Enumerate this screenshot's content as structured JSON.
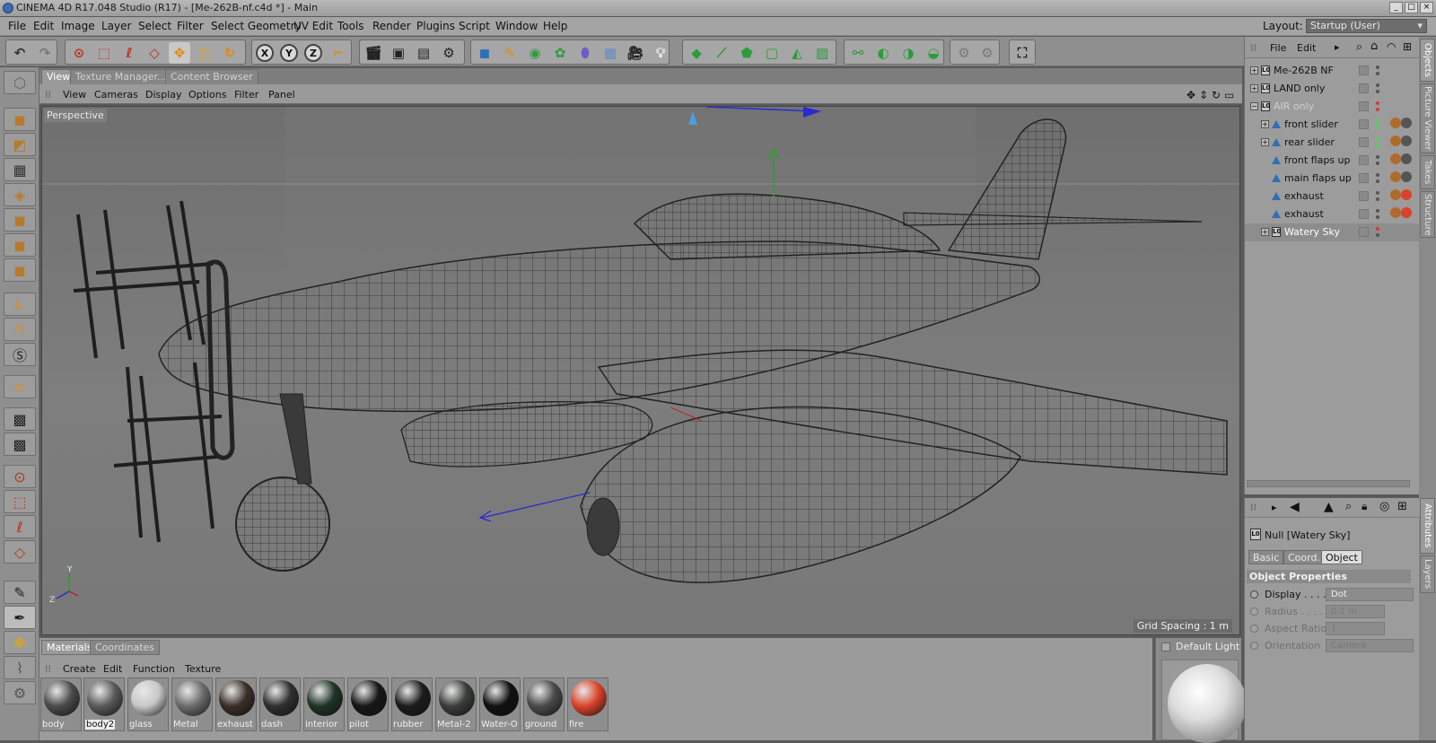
{
  "window": {
    "title": "CINEMA 4D R17.048 Studio (R17) - [Me-262B-nf.c4d *] - Main",
    "buttons": [
      "_",
      "□",
      "×"
    ]
  },
  "menu": {
    "items": [
      "File",
      "Edit",
      "Image",
      "Layer",
      "Select",
      "Filter",
      "Select Geometry",
      "UV Edit",
      "Tools",
      "Render",
      "Plugins",
      "Script",
      "Window",
      "Help"
    ],
    "layout_label": "Layout:",
    "layout_value": "Startup (User)"
  },
  "toolbar": {
    "axis": [
      "X",
      "Y",
      "Z"
    ]
  },
  "viewport": {
    "tabs": [
      "View",
      "Texture Manager...",
      "Content Browser"
    ],
    "menu": [
      "View",
      "Cameras",
      "Display",
      "Options",
      "Filter",
      "Panel"
    ],
    "label": "Perspective",
    "grid_spacing": "Grid Spacing : 1 m",
    "axis_labels": {
      "y": "Y",
      "z": "Z"
    }
  },
  "materials": {
    "tabs": [
      "Materials",
      "Coordinates"
    ],
    "menu": [
      "Create",
      "Edit",
      "Function",
      "Texture"
    ],
    "items": [
      {
        "name": "body",
        "color": "#4b4b4b"
      },
      {
        "name": "body2",
        "color": "#5a5a5a"
      },
      {
        "name": "glass",
        "color": "#c8c8c8"
      },
      {
        "name": "Metal",
        "color": "#6d6d6d"
      },
      {
        "name": "exhaust",
        "color": "#3a2e28"
      },
      {
        "name": "dash",
        "color": "#2f2f2f"
      },
      {
        "name": "interior",
        "color": "#1f3325"
      },
      {
        "name": "pilot",
        "color": "#161616"
      },
      {
        "name": "rubber",
        "color": "#1c1c1c"
      },
      {
        "name": "Metal-2",
        "color": "#3a3d3a"
      },
      {
        "name": "Water-O",
        "color": "#101010"
      },
      {
        "name": "ground",
        "color": "#4a4a4a"
      },
      {
        "name": "fire",
        "color": "#d9432a"
      }
    ],
    "preview_label": "Default Light"
  },
  "objects": {
    "menu": [
      "File",
      "Edit"
    ],
    "items": [
      {
        "name": "Me-262B NF",
        "type": "null"
      },
      {
        "name": "LAND only",
        "type": "null"
      },
      {
        "name": "AIR only",
        "type": "null"
      },
      {
        "name": "front slider",
        "type": "joint"
      },
      {
        "name": "rear slider",
        "type": "joint"
      },
      {
        "name": "front flaps up",
        "type": "joint"
      },
      {
        "name": "main flaps up",
        "type": "joint"
      },
      {
        "name": "exhaust",
        "type": "joint"
      },
      {
        "name": "exhaust",
        "type": "joint"
      },
      {
        "name": "Watery Sky",
        "type": "joint"
      }
    ]
  },
  "attributes": {
    "object_name": "Null [Watery Sky]",
    "tabs": [
      "Basic",
      "Coord.",
      "Object"
    ],
    "section": "Object Properties",
    "props": [
      {
        "label": "Display . . . .",
        "value": "Dot"
      },
      {
        "label": "Radius . . . . .",
        "value": "0.1 m"
      },
      {
        "label": "Aspect Ratio",
        "value": "1"
      },
      {
        "label": "Orientation",
        "value": "Camera"
      }
    ]
  },
  "side_tabs": [
    "Objects",
    "Picture Viewer",
    "Takes",
    "Structure",
    "Attributes",
    "Layers"
  ],
  "colors": {
    "accent_blue": "#2f6fb6",
    "active_green": "#4fd24f",
    "inactive_red": "#d23a3a"
  }
}
